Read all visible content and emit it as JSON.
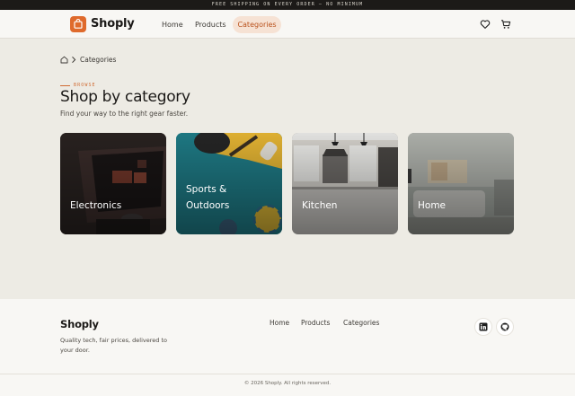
{
  "promo": {
    "text": "FREE SHIPPING ON EVERY ORDER — NO MINIMUM"
  },
  "header": {
    "logo": "Shoply",
    "nav": [
      {
        "label": "Home",
        "active": false
      },
      {
        "label": "Products",
        "active": false
      },
      {
        "label": "Categories",
        "active": true
      }
    ],
    "icons": [
      "heart-icon",
      "cart-icon"
    ]
  },
  "breadcrumb": {
    "icon": "home-icon",
    "current": "Categories"
  },
  "section": {
    "eyebrow": "BROWSE",
    "title": "Shop by category",
    "subtitle": "Find your way to the right gear faster."
  },
  "categories": [
    {
      "label": "Electronics"
    },
    {
      "label": "Sports & Outdoors"
    },
    {
      "label": "Kitchen"
    },
    {
      "label": "Home"
    }
  ],
  "footer": {
    "logo": "Shoply",
    "tagline": "Quality tech, fair prices, delivered to your door.",
    "links": [
      "Home",
      "Products",
      "Categories"
    ],
    "social": [
      "linkedin-icon",
      "github-icon"
    ],
    "copyright": "© 2026 Shoply. All rights reserved."
  },
  "colors": {
    "accent": "#df6a2c",
    "background": "#edebe4",
    "surface": "#f8f7f4",
    "active_tab_bg": "#f6e2d4"
  }
}
